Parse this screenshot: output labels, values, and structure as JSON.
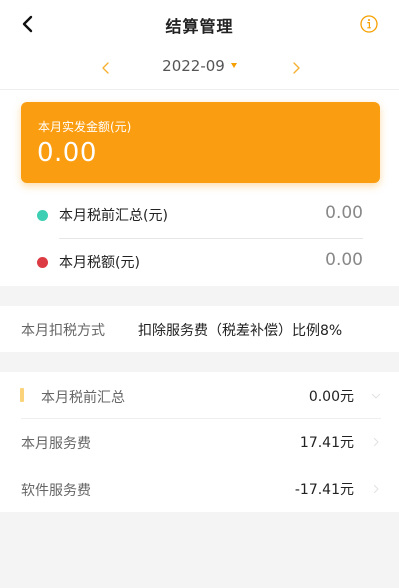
{
  "header": {
    "title": "结算管理",
    "back_icon": "chevron-left-icon",
    "info_icon": "info-circle-icon",
    "accent_color": "#f5a000"
  },
  "month_selector": {
    "month": "2022-09",
    "prev_icon": "chevron-left-icon",
    "next_icon": "chevron-right-icon"
  },
  "summary_card": {
    "label": "本月实发金额(元)",
    "value": "0.00",
    "background_color": "#fa9d10"
  },
  "summary_rows": [
    {
      "label": "本月税前汇总(元)",
      "value": "0.00",
      "dot_color": "#3dcfb3"
    },
    {
      "label": "本月税额(元)",
      "value": "0.00",
      "dot_color": "#dd3b44"
    }
  ],
  "tax_method": {
    "label": "本月扣税方式",
    "value": "扣除服务费（税差补偿）比例8%"
  },
  "breakdown": [
    {
      "label": "本月税前汇总",
      "amount": "0.00元"
    },
    {
      "label": "本月服务费",
      "amount": "17.41元"
    },
    {
      "label": "软件服务费",
      "amount": "-17.41元"
    }
  ]
}
